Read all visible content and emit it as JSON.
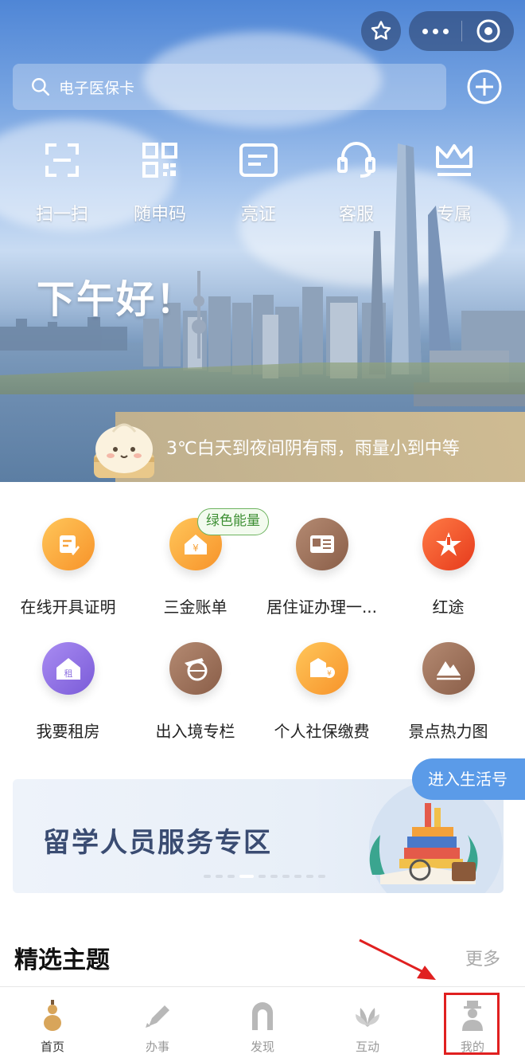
{
  "header": {
    "search_placeholder": "电子医保卡"
  },
  "quick_tools": [
    {
      "label": "扫一扫",
      "icon": "scan-icon"
    },
    {
      "label": "随申码",
      "icon": "qrcode-icon"
    },
    {
      "label": "亮证",
      "icon": "card-icon"
    },
    {
      "label": "客服",
      "icon": "headset-icon"
    },
    {
      "label": "专属",
      "icon": "crown-icon"
    }
  ],
  "greeting": "下午好！",
  "weather": "3℃白天到夜间阴有雨，雨量小到中等",
  "services": [
    {
      "label": "在线开具证明",
      "icon": "certificate-icon",
      "color": "#f7a23a"
    },
    {
      "label": "三金账单",
      "icon": "house-yuan-icon",
      "color": "#f7a23a",
      "badge": "绿色能量"
    },
    {
      "label": "居住证办理一...",
      "icon": "residence-card-icon",
      "color": "#9a6e58"
    },
    {
      "label": "红途",
      "icon": "red-star-icon",
      "color": "#ee4b26"
    },
    {
      "label": "我要租房",
      "icon": "rent-house-icon",
      "color": "#8c6fe0"
    },
    {
      "label": "出入境专栏",
      "icon": "airplane-globe-icon",
      "color": "#9a6e58"
    },
    {
      "label": "个人社保缴费",
      "icon": "social-security-icon",
      "color": "#f7a23a"
    },
    {
      "label": "景点热力图",
      "icon": "mountain-icon",
      "color": "#9a6e58"
    }
  ],
  "life_button": "进入生活号",
  "banner": {
    "title": "留学人员服务专区"
  },
  "section": {
    "title": "精选主题",
    "more": "更多"
  },
  "tabbar": [
    {
      "label": "首页",
      "icon": "gourd-icon",
      "active": true
    },
    {
      "label": "办事",
      "icon": "pen-icon",
      "active": false
    },
    {
      "label": "发现",
      "icon": "arch-icon",
      "active": false
    },
    {
      "label": "互动",
      "icon": "magnolia-icon",
      "active": false
    },
    {
      "label": "我的",
      "icon": "person-icon",
      "active": false
    }
  ],
  "colors": {
    "accent_blue": "#5b9be8",
    "badge_green": "#3d8f33",
    "annotation_red": "#e02020"
  }
}
